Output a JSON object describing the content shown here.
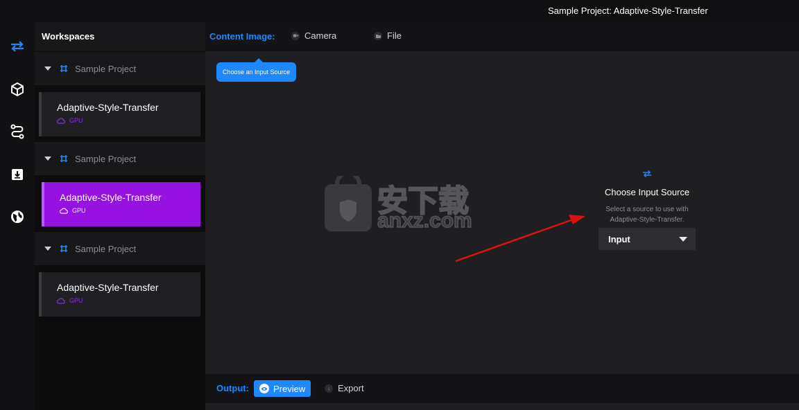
{
  "window": {
    "title": "Sample Project: Adaptive-Style-Transfer"
  },
  "rail": {
    "items": [
      {
        "icon": "swap-arrows-icon"
      },
      {
        "icon": "cube-icon"
      },
      {
        "icon": "route-icon"
      },
      {
        "icon": "download-box-icon"
      },
      {
        "icon": "globe-icon"
      }
    ],
    "active_color": "#1e88ff"
  },
  "sidebar": {
    "header": "Workspaces",
    "groups": [
      {
        "project": "Sample Project",
        "workspace": {
          "name": "Adaptive-Style-Transfer",
          "device": "GPU",
          "active": false
        }
      },
      {
        "project": "Sample Project",
        "workspace": {
          "name": "Adaptive-Style-Transfer",
          "device": "GPU",
          "active": true
        }
      },
      {
        "project": "Sample Project",
        "workspace": {
          "name": "Adaptive-Style-Transfer",
          "device": "GPU",
          "active": false
        }
      }
    ]
  },
  "content": {
    "label": "Content Image:",
    "options": [
      {
        "label": "Camera",
        "icon": "camera-icon"
      },
      {
        "label": "File",
        "icon": "file-icon"
      }
    ],
    "tooltip": "Choose an Input Source"
  },
  "input_panel": {
    "icon": "swap-arrows-icon",
    "title": "Choose Input Source",
    "description_line1": "Select a source to use with",
    "description_line2": "Adaptive-Style-Transfer.",
    "select_value": "Input"
  },
  "watermark": {
    "cn_text": "安下载",
    "domain": "anxz.com"
  },
  "output": {
    "label": "Output:",
    "preview_label": "Preview",
    "export_label": "Export"
  },
  "colors": {
    "accent": "#1e88ff",
    "active_workspace": "#9612e0",
    "arrow": "#e01010"
  }
}
